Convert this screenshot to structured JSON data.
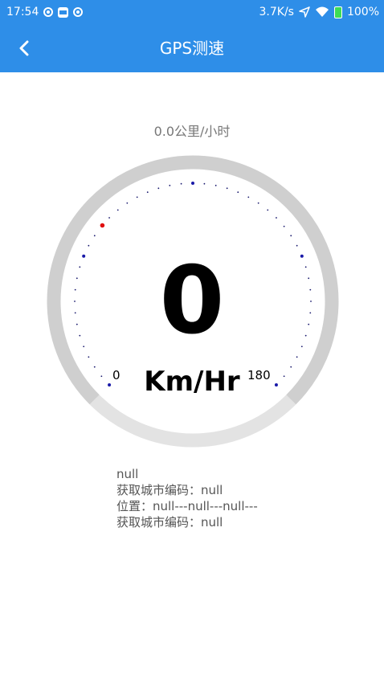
{
  "status_bar": {
    "time": "17:54",
    "network_speed": "3.7K/s",
    "battery": "100%"
  },
  "toolbar": {
    "title": "GPS测速",
    "back_icon": "chevron-left-icon"
  },
  "speed_text": "0.0公里/小时",
  "gauge": {
    "value": "0",
    "unit": "Km/Hr",
    "min_label": "0",
    "max_label": "180",
    "ring_color": "#cfcfcf",
    "ring_light_color": "#e3e3e3",
    "major_tick_color": "#1a1aa8",
    "minor_tick_color": "#1a1a6e",
    "needle_color": "#e01010"
  },
  "info_lines": [
    "null",
    "获取城市编码：null",
    "位置：null---null---null---",
    "获取城市编码：null"
  ],
  "colors": {
    "header": "#2e8ee8"
  }
}
